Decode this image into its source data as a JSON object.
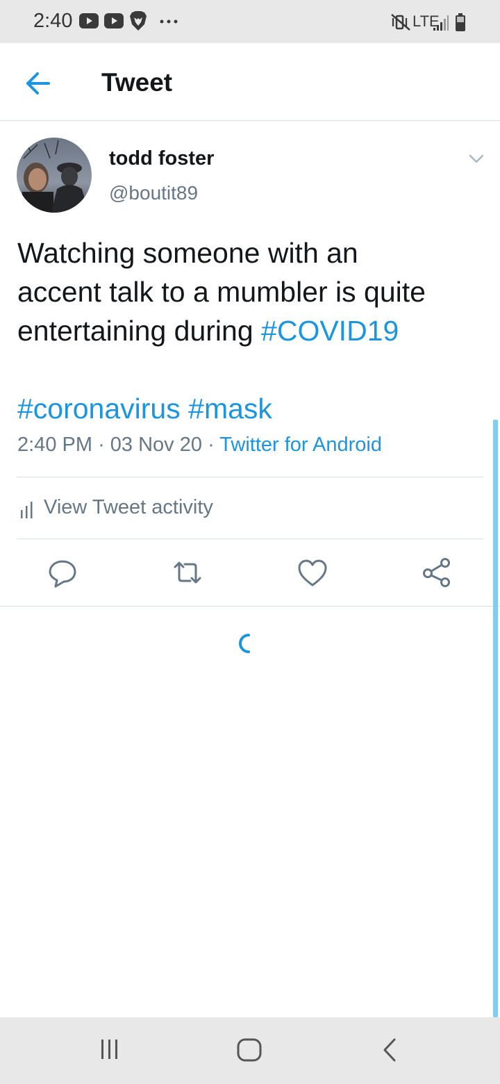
{
  "status_bar": {
    "time": "2:40",
    "network": "LTE",
    "left_icons": [
      "youtube-icon",
      "youtube-icon",
      "brave-lion-icon",
      "more-dots-icon"
    ],
    "right_icons": [
      "vibrate-mute-icon",
      "signal-icon",
      "battery-icon"
    ]
  },
  "header": {
    "title": "Tweet",
    "back_icon": "arrow-left-icon",
    "accent": "#1b95e0"
  },
  "tweet": {
    "author_name": "todd foster",
    "author_handle": "@boutit89",
    "text": {
      "line1": "Watching someone with an",
      "line2": "accent talk to a mumbler is quite",
      "line3_prefix": "entertaining during ",
      "hashtag_covid": "#COVID19",
      "hashtag_coronavirus": "#coronavirus",
      "hashtag_mask": "#mask"
    },
    "time": "2:40 PM",
    "sep": "·",
    "date": "03 Nov 20",
    "source": "Twitter for Android"
  },
  "activity": {
    "label": "View Tweet activity",
    "icon": "bar-chart-icon"
  },
  "actions": [
    {
      "name": "reply",
      "icon": "reply-bubble-icon"
    },
    {
      "name": "retweet",
      "icon": "retweet-icon"
    },
    {
      "name": "like",
      "icon": "heart-icon"
    },
    {
      "name": "share",
      "icon": "share-icon"
    }
  ],
  "nav_bar": {
    "icons": [
      "recent-apps-icon",
      "home-icon",
      "back-icon"
    ]
  }
}
